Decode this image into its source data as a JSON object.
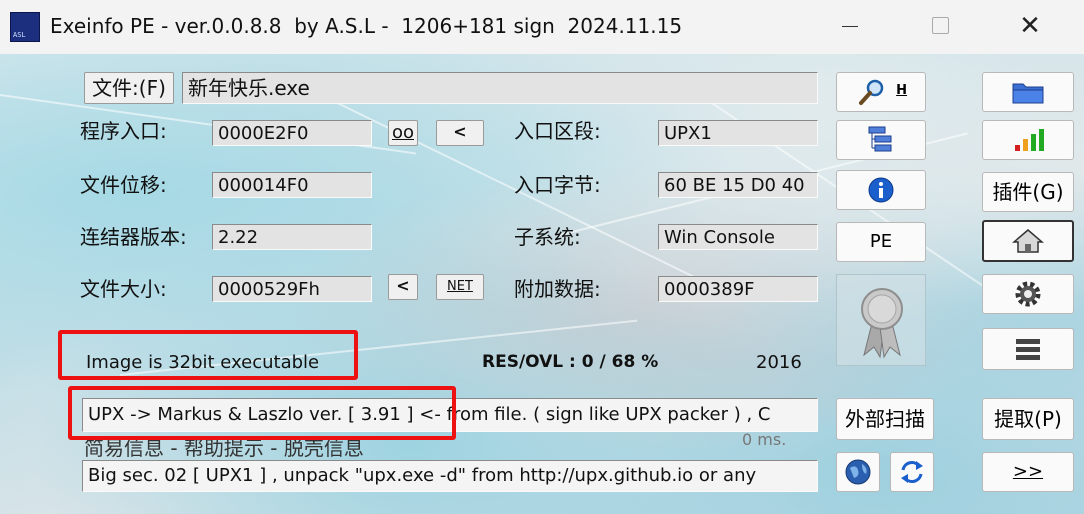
{
  "window": {
    "title": "Exeinfo PE - ver.0.0.8.8  by A.S.L -  1206+181 sign  2024.11.15",
    "close_glyph": "✕"
  },
  "file": {
    "button_label": "文件:(F)",
    "value": "新年快乐.exe"
  },
  "fields": {
    "entry_point": {
      "label": "程序入口:",
      "value": "0000E2F0"
    },
    "file_offset": {
      "label": "文件位移:",
      "value": "000014F0"
    },
    "linker": {
      "label": "连结器版本:",
      "value": "2.22"
    },
    "file_size": {
      "label": "文件大小:",
      "value": "0000529Fh"
    },
    "ep_section": {
      "label": "入口区段:",
      "value": "UPX1"
    },
    "first_bytes": {
      "label": "入口字节:",
      "value": "60 BE 15 D0 40"
    },
    "subsystem": {
      "label": "子系统:",
      "value": "Win Console"
    },
    "overlay": {
      "label": "附加数据:",
      "value": "0000389F"
    }
  },
  "small_buttons": {
    "oo": "oo",
    "lt1": "<",
    "lt2": "<",
    "net": "NET"
  },
  "info": {
    "image_type": "Image is 32bit executable",
    "res_ovl": "RES/OVL : 0 / 68 %",
    "year": "2016"
  },
  "detection": "UPX -> Markus & Laszlo ver. [ 3.91 ] <- from file. ( sign like UPX packer ) , C",
  "hint": {
    "title": "简易信息 - 帮助提示 - 脱壳信息",
    "timing": "0 ms.",
    "text": "Big sec. 02 [ UPX1 ] , unpack \"upx.exe -d\"  from  http://upx.github.io or any"
  },
  "mid_buttons": {
    "search_h": "H",
    "pe": "PE",
    "external_scan": "外部扫描"
  },
  "right_buttons": {
    "plugins": "插件(G)",
    "extract": "提取(P)",
    "next": ">>"
  },
  "colors": {
    "highlight": "#ee1111",
    "info_blue": "#1a5fcc",
    "bar_red": "#d42020",
    "bar_orange": "#f0a020",
    "bar_green": "#22aa22"
  },
  "icons": [
    "app-icon",
    "magnifier-icon",
    "tree-icon",
    "info-icon",
    "award-ribbon-icon",
    "globe-icon",
    "refresh-icon",
    "folder-icon",
    "signal-bars-icon",
    "home-icon",
    "gear-icon",
    "menu-lines-icon"
  ]
}
